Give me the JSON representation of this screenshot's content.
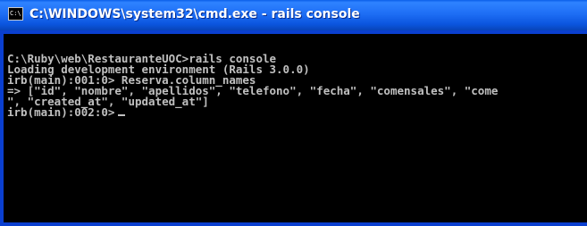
{
  "window": {
    "title": "C:\\WINDOWS\\system32\\cmd.exe - rails console",
    "icon": "cmd-icon",
    "icon_glyph": "C:\\",
    "colors": {
      "titlebar": "#1e6ef5",
      "console_background": "#000000",
      "console_text": "#c0c0c0"
    }
  },
  "console": {
    "lines": [
      "",
      "C:\\Ruby\\web\\RestauranteUOC>rails console",
      "Loading development environment (Rails 3.0.0)",
      "irb(main):001:0> Reserva.column_names",
      "=> [\"id\", \"nombre\", \"apellidos\", \"telefono\", \"fecha\", \"comensales\", \"come",
      "\", \"created_at\", \"updated_at\"]",
      "irb(main):002:0>"
    ]
  }
}
